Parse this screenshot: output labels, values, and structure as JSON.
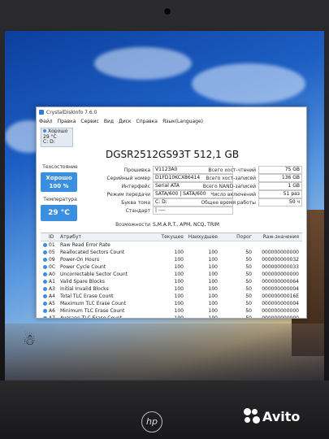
{
  "window": {
    "title": "CrystalDiskInfo 7.6.0",
    "menu": [
      "Файл",
      "Правка",
      "Сервис",
      "Вид",
      "Диск",
      "Справка",
      "Язык(Language)"
    ]
  },
  "drive_tab": {
    "status": "Хорошо",
    "temp": "29 °C",
    "letter": "C: D:"
  },
  "model": "DGSR2512GS93T 512,1 GB",
  "left_panel": {
    "status_label": "Техсостояние",
    "health_text": "Хорошо",
    "health_pct": "100 %",
    "temp_label": "Температура",
    "temp_value": "29 °C",
    "colors": {
      "health_bg": "#3a8fe0"
    }
  },
  "info": [
    {
      "k": "Прошивка",
      "v": "V1123A0"
    },
    {
      "k": "Серийный номер",
      "v": "D1FD10KCX86414"
    },
    {
      "k": "Интерфейс",
      "v": "Serial ATA"
    },
    {
      "k": "Режим передачи",
      "v": "SATA/600 | SATA/600"
    },
    {
      "k": "Буква тома",
      "v": "C: D:"
    },
    {
      "k": "Стандарт",
      "v": "| ----"
    }
  ],
  "features": {
    "k": "Возможности",
    "v": "S.M.A.R.T., APM, NCQ, TRIM"
  },
  "right_info": [
    {
      "k": "Всего хост-чтений",
      "v": "75 GB"
    },
    {
      "k": "Всего хост-записей",
      "v": "136 GB"
    },
    {
      "k": "Всего NAND-записей",
      "v": "1 GB"
    },
    {
      "k": "Число включений",
      "v": "51 раз"
    },
    {
      "k": "Общее время работы",
      "v": "50 ч"
    }
  ],
  "smart_headers": {
    "id": "ID",
    "attr": "Атрибут",
    "cur": "Текущее",
    "wor": "Наихудшее",
    "thr": "Порог",
    "raw": "Raw-значения"
  },
  "smart_rows": [
    {
      "id": "01",
      "attr": "Raw Read Error Rate",
      "cur": "",
      "wor": "",
      "thr": "",
      "raw": ""
    },
    {
      "id": "05",
      "attr": "Reallocated Sectors Count",
      "cur": "100",
      "wor": "100",
      "thr": "50",
      "raw": "000000000000"
    },
    {
      "id": "09",
      "attr": "Power-On Hours",
      "cur": "100",
      "wor": "100",
      "thr": "50",
      "raw": "000000000032"
    },
    {
      "id": "0C",
      "attr": "Power Cycle Count",
      "cur": "100",
      "wor": "100",
      "thr": "50",
      "raw": "000000000033"
    },
    {
      "id": "A0",
      "attr": "Uncorrectable Sector Count",
      "cur": "100",
      "wor": "100",
      "thr": "50",
      "raw": "000000000000"
    },
    {
      "id": "A1",
      "attr": "Valid Spare Blocks",
      "cur": "100",
      "wor": "100",
      "thr": "50",
      "raw": "000000000064"
    },
    {
      "id": "A3",
      "attr": "Initial Invalid Blocks",
      "cur": "100",
      "wor": "100",
      "thr": "50",
      "raw": "000000000004"
    },
    {
      "id": "A4",
      "attr": "Total TLC Erase Count",
      "cur": "100",
      "wor": "100",
      "thr": "50",
      "raw": "00000000016E"
    },
    {
      "id": "A5",
      "attr": "Maximum TLC Erase Count",
      "cur": "100",
      "wor": "100",
      "thr": "50",
      "raw": "000000000004"
    },
    {
      "id": "A6",
      "attr": "Minimum TLC Erase Count",
      "cur": "100",
      "wor": "100",
      "thr": "50",
      "raw": "000000000000"
    },
    {
      "id": "A7",
      "attr": "Average TLC Erase Count",
      "cur": "100",
      "wor": "100",
      "thr": "50",
      "raw": "000000000000"
    }
  ],
  "laptop": {
    "brand": "hp"
  },
  "watermark": {
    "text": "Avito"
  }
}
